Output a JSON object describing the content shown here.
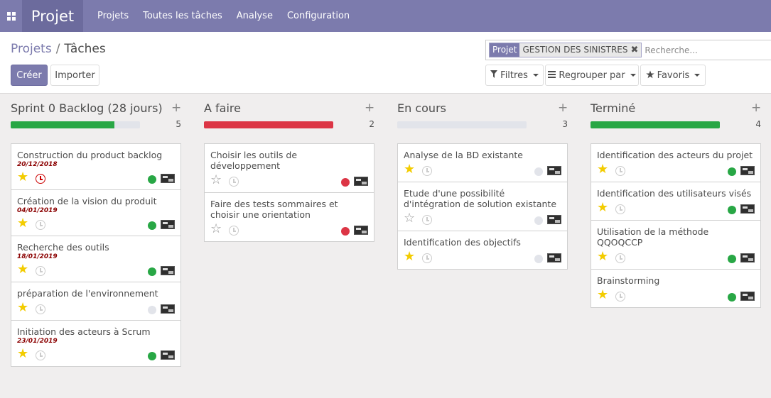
{
  "topbar": {
    "app_name": "Projet",
    "menu": [
      "Projets",
      "Toutes les tâches",
      "Analyse",
      "Configuration"
    ]
  },
  "breadcrumb": {
    "parent": "Projets",
    "separator": "/",
    "current": "Tâches"
  },
  "buttons": {
    "create": "Créer",
    "import": "Importer"
  },
  "search": {
    "facet_category": "Projet",
    "facet_value": "GESTION DES SINISTRES",
    "facet_close": "✖",
    "placeholder": "Recherche..."
  },
  "filters": {
    "filters_label": "Filtres",
    "groupby_label": "Regrouper par",
    "favorites_label": "Favoris"
  },
  "colors": {
    "accent": "#7c7bad",
    "green": "#28a745",
    "red": "#dc3545",
    "grey": "#e2e4ea",
    "star": "#f3cc00"
  },
  "columns": [
    {
      "title": "Sprint 0 Backlog (28 jours)",
      "count": "5",
      "progress_green": 0.8,
      "progress_red": 0,
      "cards": [
        {
          "title": "Construction du product backlog",
          "date": "20/12/2018",
          "starred": true,
          "late": true,
          "status": "green"
        },
        {
          "title": "Création de la vision du produit",
          "date": "04/01/2019",
          "starred": true,
          "late": false,
          "status": "green"
        },
        {
          "title": "Recherche des outils",
          "date": "18/01/2019",
          "starred": true,
          "late": false,
          "status": "green"
        },
        {
          "title": "préparation de l'environnement",
          "date": "",
          "starred": true,
          "late": false,
          "status": "grey"
        },
        {
          "title": "Initiation des acteurs à Scrum",
          "date": "23/01/2019",
          "starred": true,
          "late": false,
          "status": "green"
        }
      ]
    },
    {
      "title": "A faire",
      "count": "2",
      "progress_green": 0,
      "progress_red": 1,
      "cards": [
        {
          "title": "Choisir les outils de développement",
          "date": "",
          "starred": false,
          "late": false,
          "status": "red"
        },
        {
          "title": "Faire des tests sommaires et choisir une orientation",
          "date": "",
          "starred": false,
          "late": false,
          "status": "red"
        }
      ]
    },
    {
      "title": "En cours",
      "count": "3",
      "progress_green": 0,
      "progress_red": 0,
      "cards": [
        {
          "title": "Analyse de la BD existante",
          "date": "",
          "starred": true,
          "late": false,
          "status": "grey"
        },
        {
          "title": "Etude d'une possibilité d'intégration de solution existante",
          "date": "",
          "starred": false,
          "late": false,
          "status": "grey"
        },
        {
          "title": "Identification des objectifs",
          "date": "",
          "starred": true,
          "late": false,
          "status": "grey"
        }
      ]
    },
    {
      "title": "Terminé",
      "count": "4",
      "progress_green": 1,
      "progress_red": 0,
      "cards": [
        {
          "title": "Identification des acteurs du projet",
          "date": "",
          "starred": true,
          "late": false,
          "status": "green"
        },
        {
          "title": "Identification des utilisateurs visés",
          "date": "",
          "starred": true,
          "late": false,
          "status": "green"
        },
        {
          "title": "Utilisation de la méthode QQOQCCP",
          "date": "",
          "starred": true,
          "late": false,
          "status": "green"
        },
        {
          "title": "Brainstorming",
          "date": "",
          "starred": true,
          "late": false,
          "status": "green"
        }
      ]
    }
  ]
}
